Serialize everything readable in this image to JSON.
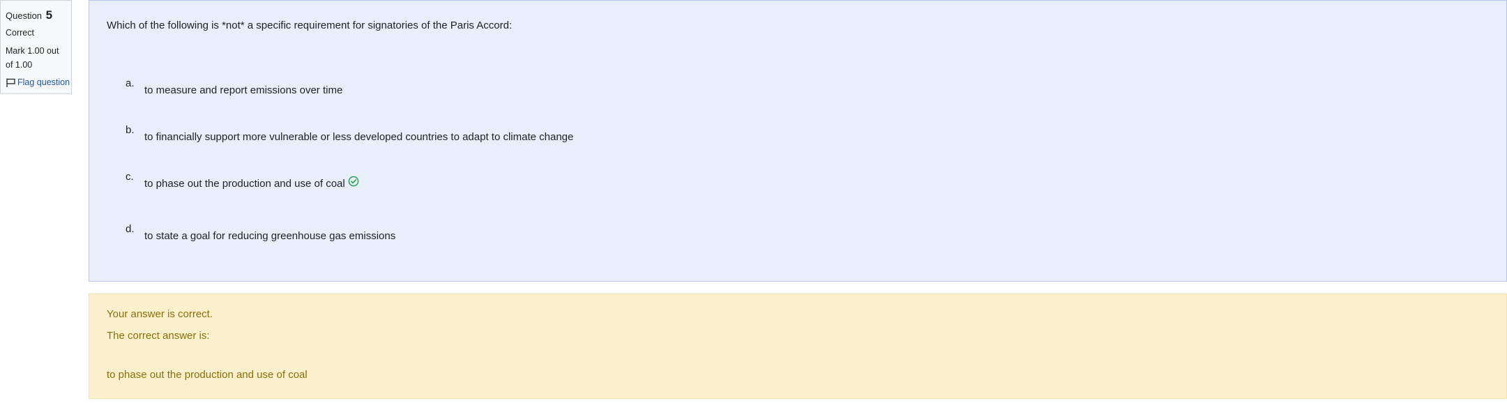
{
  "info": {
    "question_label": "Question",
    "question_number": "5",
    "state": "Correct",
    "grade": "Mark 1.00 out of 1.00",
    "flag_label": "Flag question"
  },
  "question": {
    "text": "Which of the following is *not* a specific requirement for signatories of the Paris Accord:",
    "answers": [
      {
        "letter": "a.",
        "text": "to measure and report emissions over time"
      },
      {
        "letter": "b.",
        "text": "to financially support more vulnerable or less developed countries to adapt to climate change"
      },
      {
        "letter": "c.",
        "text": "to phase out the production and use of coal",
        "correct_icon": "check-circle-icon"
      },
      {
        "letter": "d.",
        "text": "to state a goal for reducing greenhouse gas emissions"
      }
    ]
  },
  "feedback": {
    "result": "Your answer is correct.",
    "correct_answer_label": "The correct answer is:",
    "correct_answer": "to phase out the production and use of coal"
  },
  "colors": {
    "question_bg": "#e9effa",
    "feedback_bg": "#fdf1cd",
    "feedback_text": "#8a6d09",
    "link": "#1f5aa6",
    "correct_icon": "#1e9e44"
  }
}
